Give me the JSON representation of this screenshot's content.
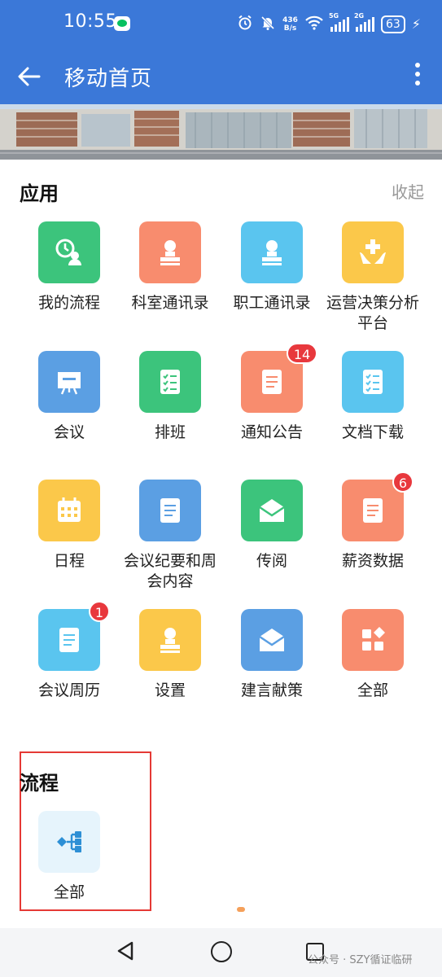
{
  "status_bar": {
    "time": "10:55",
    "net_speed_value": "436",
    "net_speed_unit": "B/s",
    "signal1_label": "5G",
    "signal2_label": "2G",
    "battery": "63"
  },
  "header": {
    "title": "移动首页"
  },
  "apps_section": {
    "title": "应用",
    "collapse_label": "收起",
    "items": [
      {
        "label": "我的流程",
        "icon": "process-clock-person-icon",
        "color": "#3cc47c"
      },
      {
        "label": "科室通讯录",
        "icon": "contact-stamp-icon",
        "color": "#f88c6e"
      },
      {
        "label": "职工通讯录",
        "icon": "contact-stamp-icon",
        "color": "#5ac5ef"
      },
      {
        "label": "运营决策分析平台",
        "icon": "hands-medical-cross-icon",
        "color": "#fbc84a"
      },
      {
        "label": "会议",
        "icon": "presentation-board-icon",
        "color": "#5b9fe3"
      },
      {
        "label": "排班",
        "icon": "checklist-icon",
        "color": "#3cc47c"
      },
      {
        "label": "通知公告",
        "icon": "document-icon",
        "color": "#f88c6e",
        "badge": "14"
      },
      {
        "label": "文档下载",
        "icon": "checklist-icon",
        "color": "#5ac5ef"
      },
      {
        "label": "日程",
        "icon": "calendar-icon",
        "color": "#fbc84a"
      },
      {
        "label": "会议纪要和周会内容",
        "icon": "document-icon",
        "color": "#5b9fe3"
      },
      {
        "label": "传阅",
        "icon": "open-envelope-icon",
        "color": "#3cc47c"
      },
      {
        "label": "薪资数据",
        "icon": "document-icon",
        "color": "#f88c6e",
        "badge": "6"
      },
      {
        "label": "会议周历",
        "icon": "document-icon",
        "color": "#5ac5ef",
        "badge": "1"
      },
      {
        "label": "设置",
        "icon": "contact-stamp-icon",
        "color": "#fbc84a"
      },
      {
        "label": "建言献策",
        "icon": "open-envelope-icon",
        "color": "#5b9fe3"
      },
      {
        "label": "全部",
        "icon": "grid-apps-icon",
        "color": "#f88c6e"
      }
    ]
  },
  "process_section": {
    "title": "流程",
    "items": [
      {
        "label": "全部",
        "icon": "process-tree-icon",
        "color": "#e6f4fc"
      }
    ]
  },
  "watermark": "公众号 · SZY循证临研"
}
